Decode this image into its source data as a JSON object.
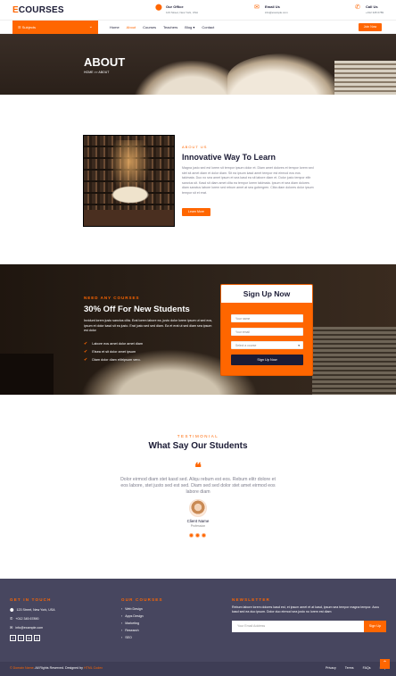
{
  "brand": {
    "logo_accent": "E",
    "logo_rest": "COURSES"
  },
  "topbar": {
    "office_title": "Our Office",
    "office_value": "123 Street, New York, USA",
    "email_title": "Email Us",
    "email_value": "info@example.com",
    "call_title": "Call Us",
    "call_value": "+012 345 6789"
  },
  "nav": {
    "subjects": "Subjects",
    "items": [
      "Home",
      "About",
      "Courses",
      "Teachers",
      "Blog",
      "Contact"
    ],
    "active": "About",
    "join": "Join Now"
  },
  "hero": {
    "title": "ABOUT",
    "crumb_home": "HOME",
    "crumb_sep": ">>",
    "crumb_current": "ABOUT"
  },
  "about": {
    "kicker": "ABOUT US",
    "title": "Innovative Way To Learn",
    "text": "Magna justo sed est lorem sit tempor ipsum dolor et. Diam amet dolores et tempor lorem sed stet sit amet diam et dolor diam. Sit ea ipsum kasd amet tempor est eirmod eos eos takimata. Duo no sea amet ipsum et sea kasd ea sit labore diam et. Dolor justo tempor elitr sanctus sit. Kasd sit diam amet clita ea tempor lorem takimata. Ipsum et sea diam dolores diam sanctus labore lorem sed rebum amet at sea gubergren. Clita diam dolores dolor ipsum tempor sit et erat.",
    "button": "Learn More"
  },
  "promo": {
    "kicker": "NEED ANY COURSES",
    "title": "30% Off For New Students",
    "text": "Invidunt lorem justo sanctus clita. Erat lorem labore ea, justo dolor lorem ipsum ut sed eos, ipsum et dolor kasd sit ea justo. Erat justo sed sed diam. Ea et erat ut sed diam sea ipsum est dolor",
    "list": [
      "Labore eos amet dolor amet diam",
      "Etsea et sit dolor amet ipsum",
      "Diam dolor diam elitripsum vero."
    ]
  },
  "signup": {
    "title": "Sign Up Now",
    "name_placeholder": "Your name",
    "email_placeholder": "Your email",
    "select_value": "Select a course",
    "button": "Sign Up Now"
  },
  "testimonial": {
    "kicker": "TESTIMONIAL",
    "title": "What Say Our Students",
    "text": "Dolor eirmod diam stet kasd sed. Aliqu rebum est eos. Rebum elitr dolore et eos labore, stet justo sed est sed. Diam sed sed dolor stet amet eirmod eos labore diam",
    "name": "Client Name",
    "profession": "Profession"
  },
  "footer": {
    "get_in_touch": "GET IN TOUCH",
    "address": "123 Street, New York, USA",
    "phone": "+012 345 67890",
    "email": "info@example.com",
    "courses_title": "OUR COURSES",
    "courses": [
      "Web Design",
      "Apps Design",
      "Marketing",
      "Research",
      "SEO"
    ],
    "newsletter_title": "NEWSLETTER",
    "newsletter_text": "Rebum labore lorem dolores kasd est, et ipsum amet et at kasd, ipsum sea tempor magna tempor. Accu kasd sed ea duo ipsum. Dolor duo eirmod sea justo no lorem est diam",
    "newsletter_placeholder": "Your Email Address",
    "newsletter_button": "Sign Up",
    "copy_brand": "© Domain Name",
    "copy_rest": ". All Rights Reserved. Designed by",
    "copy_designer": "HTML Codex",
    "links": [
      "Privacy",
      "Terms",
      "FAQs",
      "Help"
    ]
  },
  "colors": {
    "accent": "#ff6600",
    "dark": "#1b1b35",
    "footer": "#47465f"
  }
}
